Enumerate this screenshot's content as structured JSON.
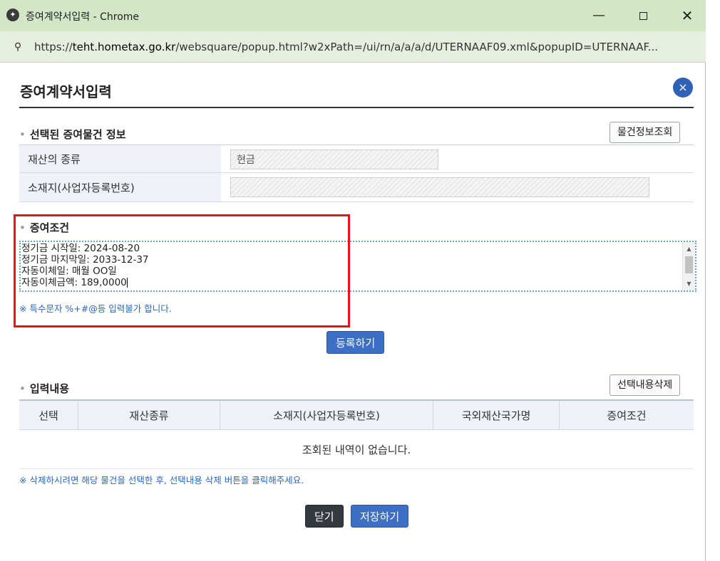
{
  "window": {
    "title": "증여계약서입력 - Chrome",
    "favicon_glyph": "✦",
    "minimize_glyph": "—",
    "close_glyph": "✕"
  },
  "address_bar": {
    "icon_glyph": "⚲",
    "url_prefix": "https://",
    "url_host": "teht.hometax.go.kr",
    "url_rest": "/websquare/popup.html?w2xPath=/ui/rn/a/a/a/d/UTERNAAF09.xml&popupID=UTERNAAF..."
  },
  "popup": {
    "title": "증여계약서입력",
    "close_glyph": "×"
  },
  "selected_item": {
    "section_title": "선택된 증여물건 정보",
    "lookup_button": "물건정보조회",
    "rows": [
      {
        "label": "재산의 종류",
        "value": "현금"
      },
      {
        "label": "소재지(사업자등록번호)",
        "value": ""
      }
    ]
  },
  "gift_condition": {
    "section_title": "증여조건",
    "text": "정기금 시작일: 2024-08-20\n정기금 마지막일: 2033-12-37\n자동이체일: 매월 OO일\n자동이체금액: 189,0000",
    "note": "※ 특수문자 %+#@등 입력불가 합니다.",
    "register_button": "등록하기"
  },
  "entered": {
    "section_title": "입력내용",
    "delete_button": "선택내용삭제",
    "columns": [
      "선택",
      "재산종류",
      "소재지(사업자등록번호)",
      "국외재산국가명",
      "증여조건"
    ],
    "empty_message": "조회된 내역이 없습니다.",
    "note": "※ 삭제하시려면 해당 물건을 선택한 후, 선택내용 삭제 버튼을 클릭해주세요."
  },
  "footer": {
    "close_button": "닫기",
    "save_button": "저장하기"
  },
  "colors": {
    "titlebar": "#d3e7c7",
    "accent_blue": "#3d6fc2",
    "highlight_red": "#e5151b"
  }
}
